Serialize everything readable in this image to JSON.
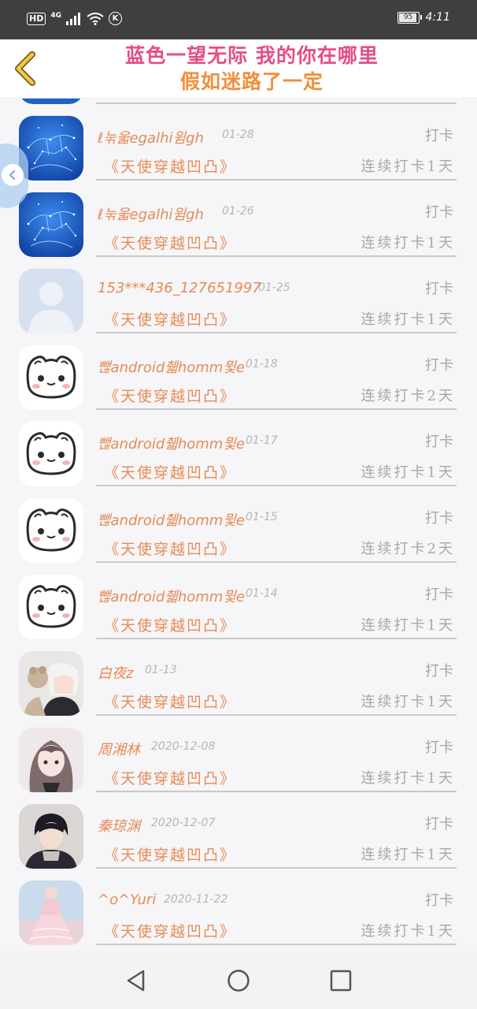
{
  "status_bar": {
    "hd": "HD",
    "network": "4G",
    "k_badge": "K",
    "battery_level": 95,
    "battery_text": "95",
    "time": "4:11"
  },
  "header": {
    "marquee_line1": "蓝色一望无际 我的你在哪里",
    "marquee_line2": "假如迷路了一定"
  },
  "colors": {
    "name": "#e48c57",
    "muted": "#a8a8a8",
    "date": "#b6b6b6",
    "marquee_pink": "#e64d86",
    "marquee_orange": "#f08f3b"
  },
  "rows": [
    {
      "name": "ℓ눆욻egalhi윔gh",
      "date": "01-28",
      "checkin": "打卡",
      "book": "《天使穿越凹凸》",
      "streak": "连续打卡1天",
      "avatar": "constellation-avatar"
    },
    {
      "name": "ℓ눆욻egalhi윔gh",
      "date": "01-26",
      "checkin": "打卡",
      "book": "《天使穿越凹凸》",
      "streak": "连续打卡1天",
      "avatar": "constellation-avatar"
    },
    {
      "name": "153***436_127651997",
      "date": "01-25",
      "checkin": "打卡",
      "book": "《天使穿越凹凸》",
      "streak": "连续打卡1天",
      "avatar": "default-user-avatar"
    },
    {
      "name": "뺂android췗homm뮟e",
      "date": "01-18",
      "checkin": "打卡",
      "book": "《天使穿越凹凸》",
      "streak": "连续打卡2天",
      "avatar": "cat-avatar"
    },
    {
      "name": "뺂android췗homm뮟e",
      "date": "01-17",
      "checkin": "打卡",
      "book": "《天使穿越凹凸》",
      "streak": "连续打卡1天",
      "avatar": "cat-avatar"
    },
    {
      "name": "뺂android췗homm뮟e",
      "date": "01-15",
      "checkin": "打卡",
      "book": "《天使穿越凹凸》",
      "streak": "连续打卡2天",
      "avatar": "cat-avatar"
    },
    {
      "name": "뺂android췗homm뮟e",
      "date": "01-14",
      "checkin": "打卡",
      "book": "《天使穿越凹凸》",
      "streak": "连续打卡1天",
      "avatar": "cat-avatar"
    },
    {
      "name": "白夜z",
      "date": "01-13",
      "checkin": "打卡",
      "book": "《天使穿越凹凸》",
      "streak": "连续打卡1天",
      "avatar": "anime-boy-avatar"
    },
    {
      "name": "周湘林",
      "date": "2020-12-08",
      "checkin": "打卡",
      "book": "《天使穿越凹凸》",
      "streak": "连续打卡1天",
      "avatar": "anime-girl-avatar"
    },
    {
      "name": "秦琼渊",
      "date": "2020-12-07",
      "checkin": "打卡",
      "book": "《天使穿越凹凸》",
      "streak": "连续打卡1天",
      "avatar": "dark-boy-avatar"
    },
    {
      "name": "^o^Yuri",
      "date": "2020-11-22",
      "checkin": "打卡",
      "book": "《天使穿越凹凸》",
      "streak": "连续打卡1天",
      "avatar": "pink-dress-avatar"
    }
  ]
}
